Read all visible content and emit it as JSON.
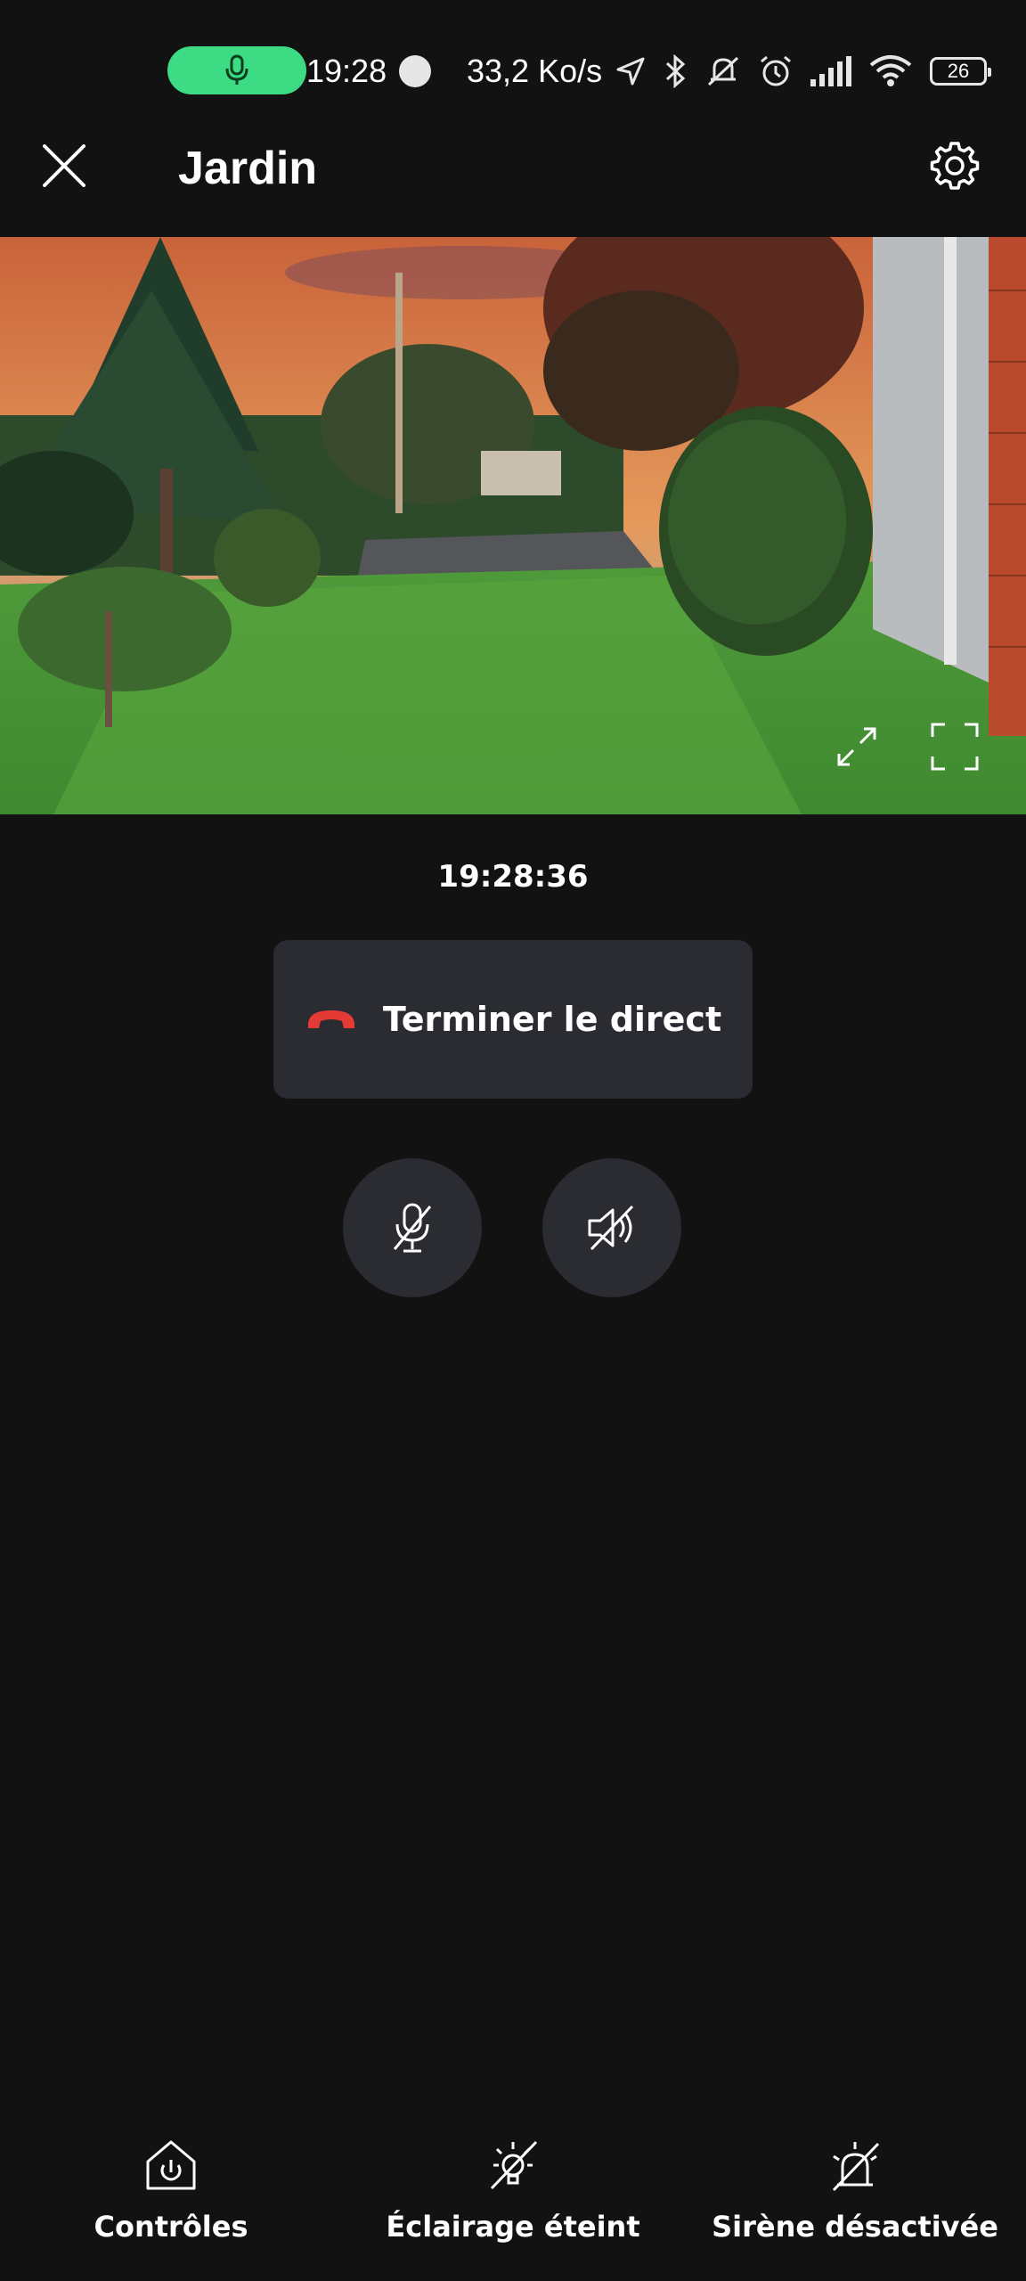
{
  "status_bar": {
    "time": "19:28",
    "network_speed": "33,2 Ko/s",
    "battery_level": "26",
    "active_indicator_color": "#3ddc84",
    "icons": [
      "mic-icon",
      "notification-dot-icon",
      "location-arrow-icon",
      "bluetooth-icon",
      "notifications-off-icon",
      "alarm-icon",
      "signal-icon",
      "wifi-icon",
      "battery-icon"
    ]
  },
  "header": {
    "title": "Jardin",
    "close_icon": "close-icon",
    "settings_icon": "gear-icon"
  },
  "feed": {
    "timestamp": "19:28:36",
    "controls": [
      "collapse-icon",
      "fullscreen-icon"
    ]
  },
  "call": {
    "end_live_label": "Terminer le direct",
    "end_icon_color": "#e53935",
    "mic_state": "muted",
    "speaker_state": "muted"
  },
  "bottom_nav": {
    "items": [
      {
        "label": "Contrôles",
        "icon": "home-power-icon"
      },
      {
        "label": "Éclairage éteint",
        "icon": "light-off-icon"
      },
      {
        "label": "Sirène désactivée",
        "icon": "siren-off-icon"
      }
    ]
  }
}
